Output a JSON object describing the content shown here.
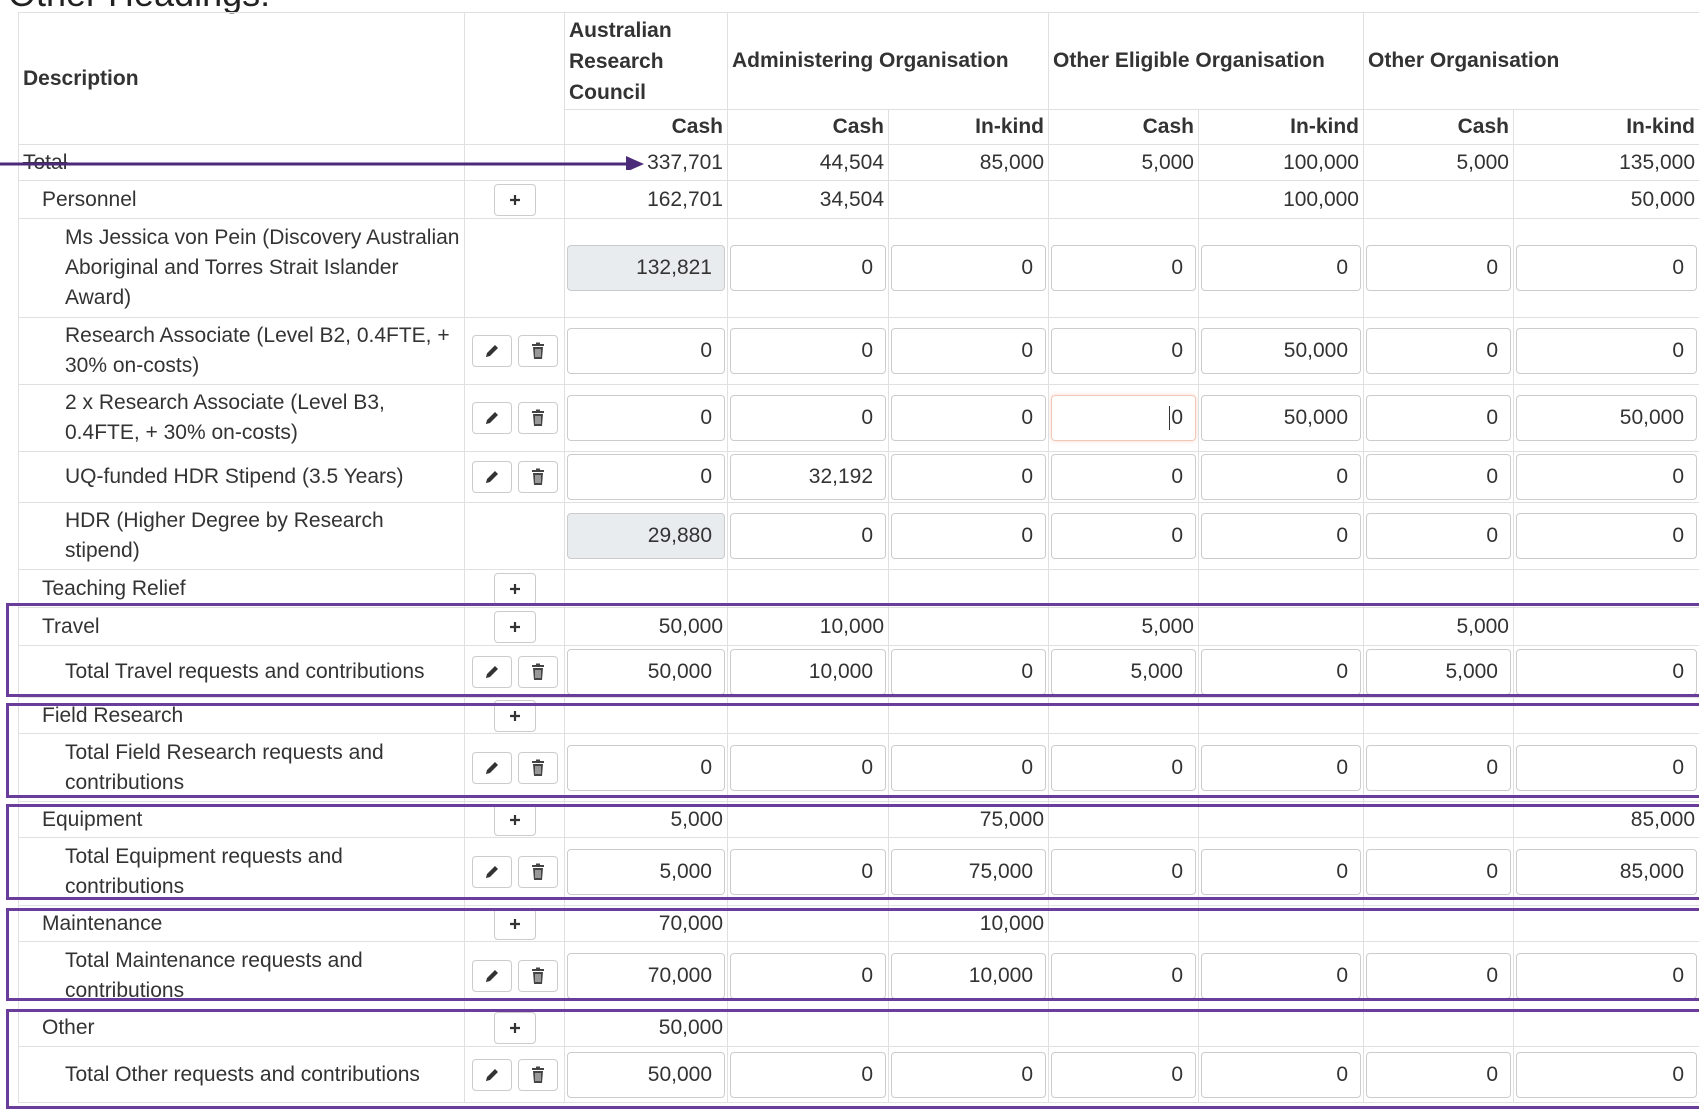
{
  "page_heading": "Other Headings:",
  "colors": {
    "highlight": "#6a3d9a",
    "border": "#e0e0e0",
    "readonly_bg": "#e9ecef"
  },
  "headers": {
    "description": "Description",
    "orgs": [
      "Australian Research Council",
      "Administering Organisation",
      "Other Eligible Organisation",
      "Other Organisation"
    ],
    "sub": [
      "Cash",
      "Cash",
      "In-kind",
      "Cash",
      "In-kind",
      "Cash",
      "In-kind"
    ]
  },
  "rows": {
    "total": {
      "label": "Total",
      "values": [
        "337,701",
        "44,504",
        "85,000",
        "5,000",
        "100,000",
        "5,000",
        "135,000"
      ]
    },
    "personnel": {
      "label": "Personnel",
      "values": [
        "162,701",
        "34,504",
        "",
        "",
        "100,000",
        "",
        "50,000"
      ]
    },
    "pers_1": {
      "label": "Ms Jessica von Pein (Discovery Australian Aboriginal and Torres Strait Islander Award)",
      "values": [
        "132,821",
        "0",
        "0",
        "0",
        "0",
        "0",
        "0"
      ]
    },
    "pers_2": {
      "label": "Research Associate (Level B2, 0.4FTE, + 30% on-costs)",
      "values": [
        "0",
        "0",
        "0",
        "0",
        "50,000",
        "0",
        "0"
      ]
    },
    "pers_3": {
      "label": "2 x Research Associate (Level B3, 0.4FTE, + 30% on-costs)",
      "values": [
        "0",
        "0",
        "0",
        "0",
        "50,000",
        "0",
        "50,000"
      ]
    },
    "pers_4": {
      "label": "UQ-funded HDR Stipend (3.5 Years)",
      "values": [
        "0",
        "32,192",
        "0",
        "0",
        "0",
        "0",
        "0"
      ]
    },
    "pers_5": {
      "label": "HDR (Higher Degree by Research stipend)",
      "values": [
        "29,880",
        "0",
        "0",
        "0",
        "0",
        "0",
        "0"
      ]
    },
    "teaching": {
      "label": "Teaching Relief",
      "values": [
        "",
        "",
        "",
        "",
        "",
        "",
        ""
      ]
    },
    "travel": {
      "label": "Travel",
      "values": [
        "50,000",
        "10,000",
        "",
        "5,000",
        "",
        "5,000",
        ""
      ]
    },
    "travel_total": {
      "label": "Total Travel requests and contributions",
      "values": [
        "50,000",
        "10,000",
        "0",
        "5,000",
        "0",
        "5,000",
        "0"
      ]
    },
    "field": {
      "label": "Field Research",
      "values": [
        "",
        "",
        "",
        "",
        "",
        "",
        ""
      ]
    },
    "field_total": {
      "label": "Total Field Research requests and contributions",
      "values": [
        "0",
        "0",
        "0",
        "0",
        "0",
        "0",
        "0"
      ]
    },
    "equipment": {
      "label": "Equipment",
      "values": [
        "5,000",
        "",
        "75,000",
        "",
        "",
        "",
        "85,000"
      ]
    },
    "equipment_total": {
      "label": "Total Equipment requests and contributions",
      "values": [
        "5,000",
        "0",
        "75,000",
        "0",
        "0",
        "0",
        "85,000"
      ]
    },
    "maintenance": {
      "label": "Maintenance",
      "values": [
        "70,000",
        "",
        "10,000",
        "",
        "",
        "",
        ""
      ]
    },
    "maintenance_total": {
      "label": "Total Maintenance requests and contributions",
      "values": [
        "70,000",
        "0",
        "10,000",
        "0",
        "0",
        "0",
        "0"
      ]
    },
    "other": {
      "label": "Other",
      "values": [
        "50,000",
        "",
        "",
        "",
        "",
        "",
        ""
      ]
    },
    "other_total": {
      "label": "Total Other requests and contributions",
      "values": [
        "50,000",
        "0",
        "0",
        "0",
        "0",
        "0",
        "0"
      ]
    }
  },
  "icons": {
    "add": "plus-icon",
    "edit": "pencil-icon",
    "delete": "trash-icon"
  }
}
